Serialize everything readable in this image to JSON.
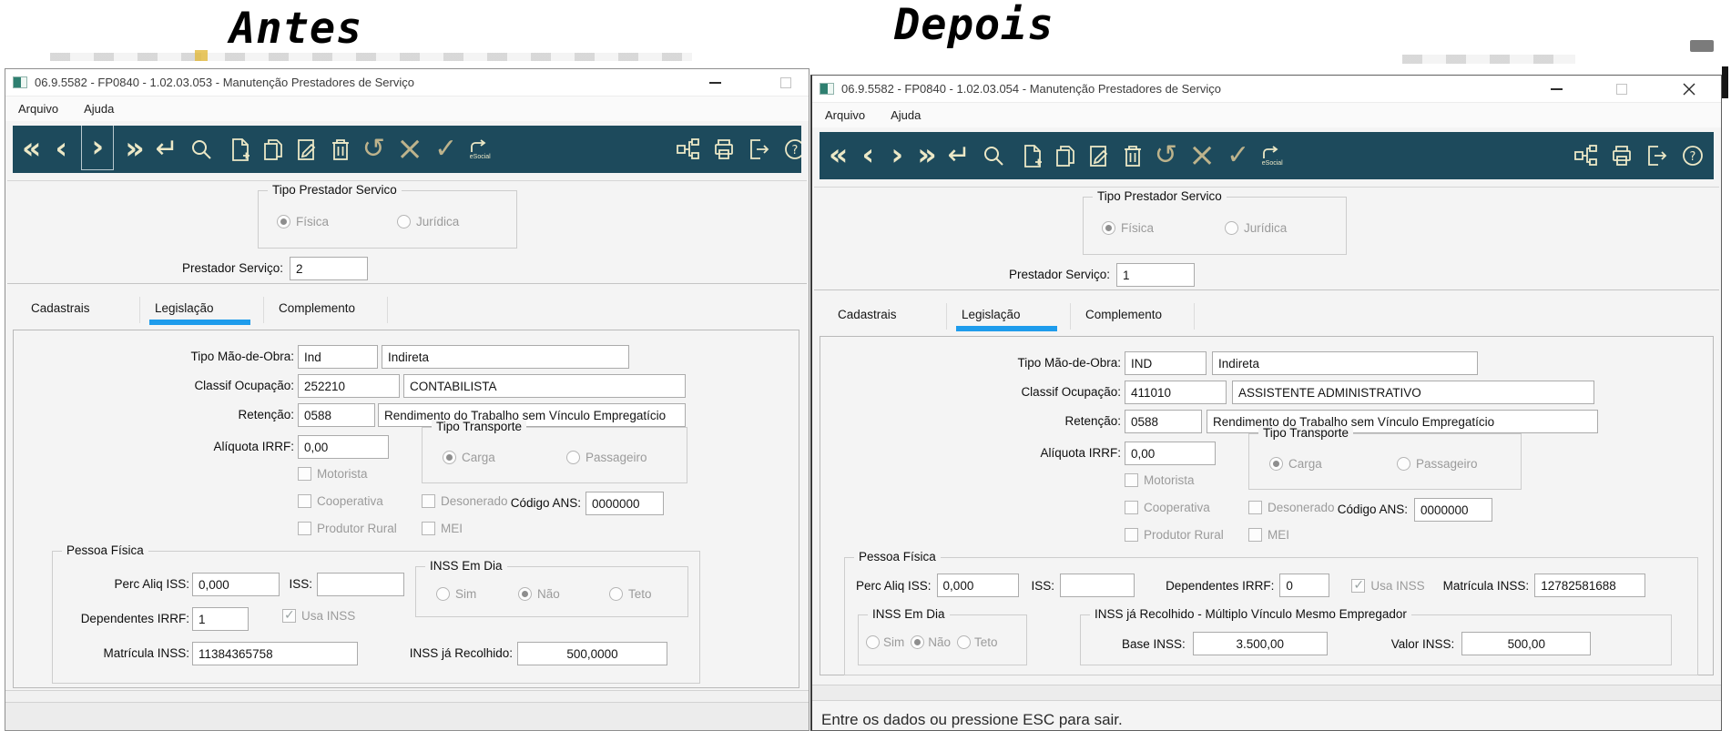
{
  "headers": {
    "before": "Antes",
    "after": "Depois"
  },
  "menu": {
    "arquivo": "Arquivo",
    "ajuda": "Ajuda"
  },
  "toolbar": {
    "glyphs": {
      "first": "«",
      "previous": "‹",
      "next": "›",
      "last": "»",
      "enter": "↵",
      "undo": "↺",
      "cancel": "×",
      "confirm": "✓"
    },
    "esocial_label": "eSocial",
    "icon_names": [
      "first",
      "previous",
      "next",
      "last",
      "enter",
      "search",
      "new-document",
      "copy-document",
      "edit-document",
      "delete",
      "undo",
      "cancel",
      "confirm",
      "esocial",
      "hierarchy",
      "print",
      "exit",
      "help"
    ]
  },
  "shared": {
    "tipo_prestador": {
      "legend": "Tipo Prestador Servico",
      "fisica": "Física",
      "juridica": "Jurídica"
    },
    "prestador_label": "Prestador Serviço:",
    "tabs": [
      "Cadastrais",
      "Legislação",
      "Complemento"
    ],
    "labels": {
      "tipo_mao": "Tipo Mão-de-Obra:",
      "classif": "Classif Ocupação:",
      "retencao": "Retenção:",
      "aliquota": "Alíquota IRRF:",
      "tipo_transporte": "Tipo Transporte",
      "carga": "Carga",
      "passageiro": "Passageiro",
      "motorista": "Motorista",
      "cooperativa": "Cooperativa",
      "produtor_rural": "Produtor Rural",
      "desonerado": "Desonerado",
      "mei": "MEI",
      "codigo_ans": "Código ANS:",
      "pessoa_fisica": "Pessoa Física",
      "perc_aliq_iss": "Perc Aliq ISS:",
      "iss": "ISS:",
      "inss_em_dia": "INSS Em Dia",
      "sim": "Sim",
      "nao": "Não",
      "teto": "Teto",
      "dependentes_irrf": "Dependentes IRRF:",
      "usa_inss": "Usa INSS",
      "matricula_inss": "Matrícula INSS:"
    }
  },
  "before": {
    "title": "06.9.5582 - FP0840 - 1.02.03.053 - Manutenção Prestadores de Serviço",
    "prestador_value": "2",
    "tipo_mao_code": "Ind",
    "tipo_mao_desc": "Indireta",
    "classif_code": "252210",
    "classif_desc": "CONTABILISTA",
    "retencao_code": "0588",
    "retencao_desc": "Rendimento do Trabalho sem Vínculo Empregatício",
    "aliquota_value": "0,00",
    "codigo_ans_value": "0000000",
    "perc_aliq_value": "0,000",
    "iss_value": "",
    "dependentes_value": "1",
    "matricula_value": "11384365758",
    "inss_recolhido_label": "INSS já Recolhido:",
    "inss_recolhido_value": "500,0000"
  },
  "after": {
    "title": "06.9.5582 - FP0840 - 1.02.03.054 - Manutenção Prestadores de Serviço",
    "prestador_value": "1",
    "tipo_mao_code": "IND",
    "tipo_mao_desc": "Indireta",
    "classif_code": "411010",
    "classif_desc": "ASSISTENTE ADMINISTRATIVO",
    "retencao_code": "0588",
    "retencao_desc": "Rendimento do Trabalho sem Vínculo Empregatício",
    "aliquota_value": "0,00",
    "codigo_ans_value": "0000000",
    "perc_aliq_value": "0,000",
    "iss_value": "",
    "dependentes_value": "0",
    "matricula_value": "12782581688",
    "multiplo_legend": "INSS já Recolhido - Múltiplo Vínculo Mesmo Empregador",
    "base_inss_label": "Base INSS:",
    "base_inss_value": "3.500,00",
    "valor_inss_label": "Valor INSS:",
    "valor_inss_value": "500,00",
    "status": "Entre os dados ou pressione ESC para sair."
  },
  "colors": {
    "toolbar_bg": "#1d4a5c",
    "toolbar_icon": "#ece8c6",
    "toolbar_icon_dim": "#bdb38c",
    "tab_active_underline": "#1e9cec"
  }
}
